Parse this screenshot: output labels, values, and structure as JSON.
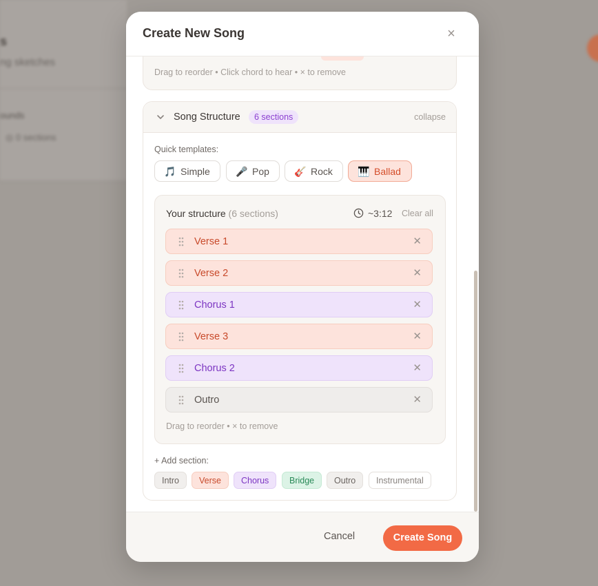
{
  "background": {
    "title": "s",
    "subtitle": "ng sketches",
    "item": "ounds",
    "item2": "◎ 0 sections"
  },
  "modal": {
    "title": "Create New Song",
    "close_icon": "×"
  },
  "previous_section": {
    "hint": "Drag to reorder • Click chord to hear • × to remove"
  },
  "structure": {
    "title": "Song Structure",
    "badge": "6 sections",
    "collapse": "collapse",
    "quick_templates_label": "Quick templates:",
    "templates": [
      {
        "icon": "🎵",
        "label": "Simple",
        "active": false
      },
      {
        "icon": "🎤",
        "label": "Pop",
        "active": false
      },
      {
        "icon": "🎸",
        "label": "Rock",
        "active": false
      },
      {
        "icon": "🎹",
        "label": "Ballad",
        "active": true
      }
    ],
    "your_structure": {
      "title": "Your structure",
      "count": "(6 sections)",
      "duration": "~3:12",
      "clear_all": "Clear all",
      "sections": [
        {
          "label": "Verse 1",
          "type": "verse"
        },
        {
          "label": "Verse 2",
          "type": "verse"
        },
        {
          "label": "Chorus 1",
          "type": "chorus"
        },
        {
          "label": "Verse 3",
          "type": "verse"
        },
        {
          "label": "Chorus 2",
          "type": "chorus"
        },
        {
          "label": "Outro",
          "type": "outro"
        }
      ],
      "hint": "Drag to reorder • × to remove"
    },
    "add_section_label": "+ Add section:",
    "add_chips": [
      {
        "label": "Intro",
        "type": "intro"
      },
      {
        "label": "Verse",
        "type": "verse"
      },
      {
        "label": "Chorus",
        "type": "chorus"
      },
      {
        "label": "Bridge",
        "type": "bridge"
      },
      {
        "label": "Outro",
        "type": "outro"
      },
      {
        "label": "Instrumental",
        "type": "instr"
      }
    ]
  },
  "footer": {
    "cancel": "Cancel",
    "create": "Create Song"
  },
  "colors": {
    "accent": "#f26a45",
    "verse": "#fde3dc",
    "chorus": "#efe3fb",
    "bridge": "#dcf3e6",
    "outro": "#efedeb"
  }
}
